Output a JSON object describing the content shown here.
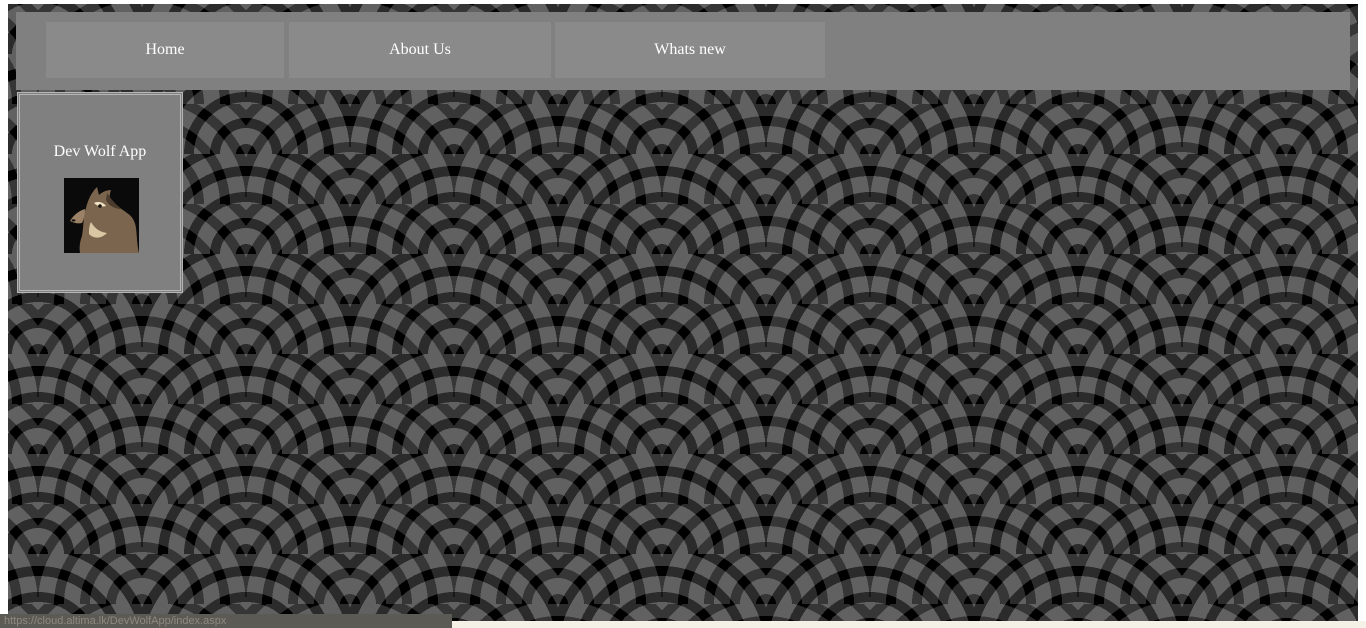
{
  "nav": {
    "items": [
      {
        "label": "Home"
      },
      {
        "label": "About Us"
      },
      {
        "label": "Whats new"
      }
    ]
  },
  "app_card": {
    "title": "Dev Wolf App",
    "image_alt": "wolf-image"
  },
  "status_bar": {
    "url": "https://cloud.altima.lk/DevWolfApp/index.aspx"
  },
  "colors": {
    "nav_background": "#808080",
    "nav_item_background": "#8a8a8a",
    "page_pattern_dark": "#000000",
    "page_pattern_light": "#5f5f5f",
    "text": "#ffffff"
  }
}
